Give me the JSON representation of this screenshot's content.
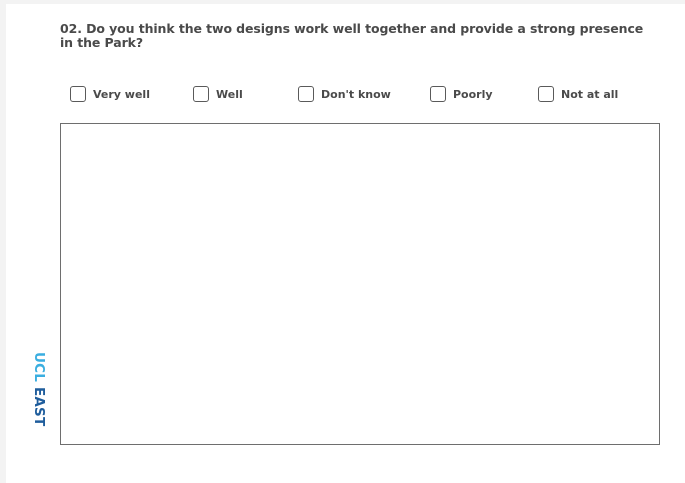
{
  "question": {
    "line1": "02. Do you think the two designs work well together and provide a strong presence",
    "line2": "in the Park?"
  },
  "options": [
    {
      "label": "Very well",
      "checked": false
    },
    {
      "label": "Well",
      "checked": false
    },
    {
      "label": "Don't know",
      "checked": false
    },
    {
      "label": "Poorly",
      "checked": false
    },
    {
      "label": "Not at all",
      "checked": false
    }
  ],
  "answer_box": {
    "value": ""
  },
  "brand": {
    "part1": "UCL",
    "part2": "EAST",
    "color_ucl": "#3aaee0",
    "color_east": "#1f5d9c"
  }
}
